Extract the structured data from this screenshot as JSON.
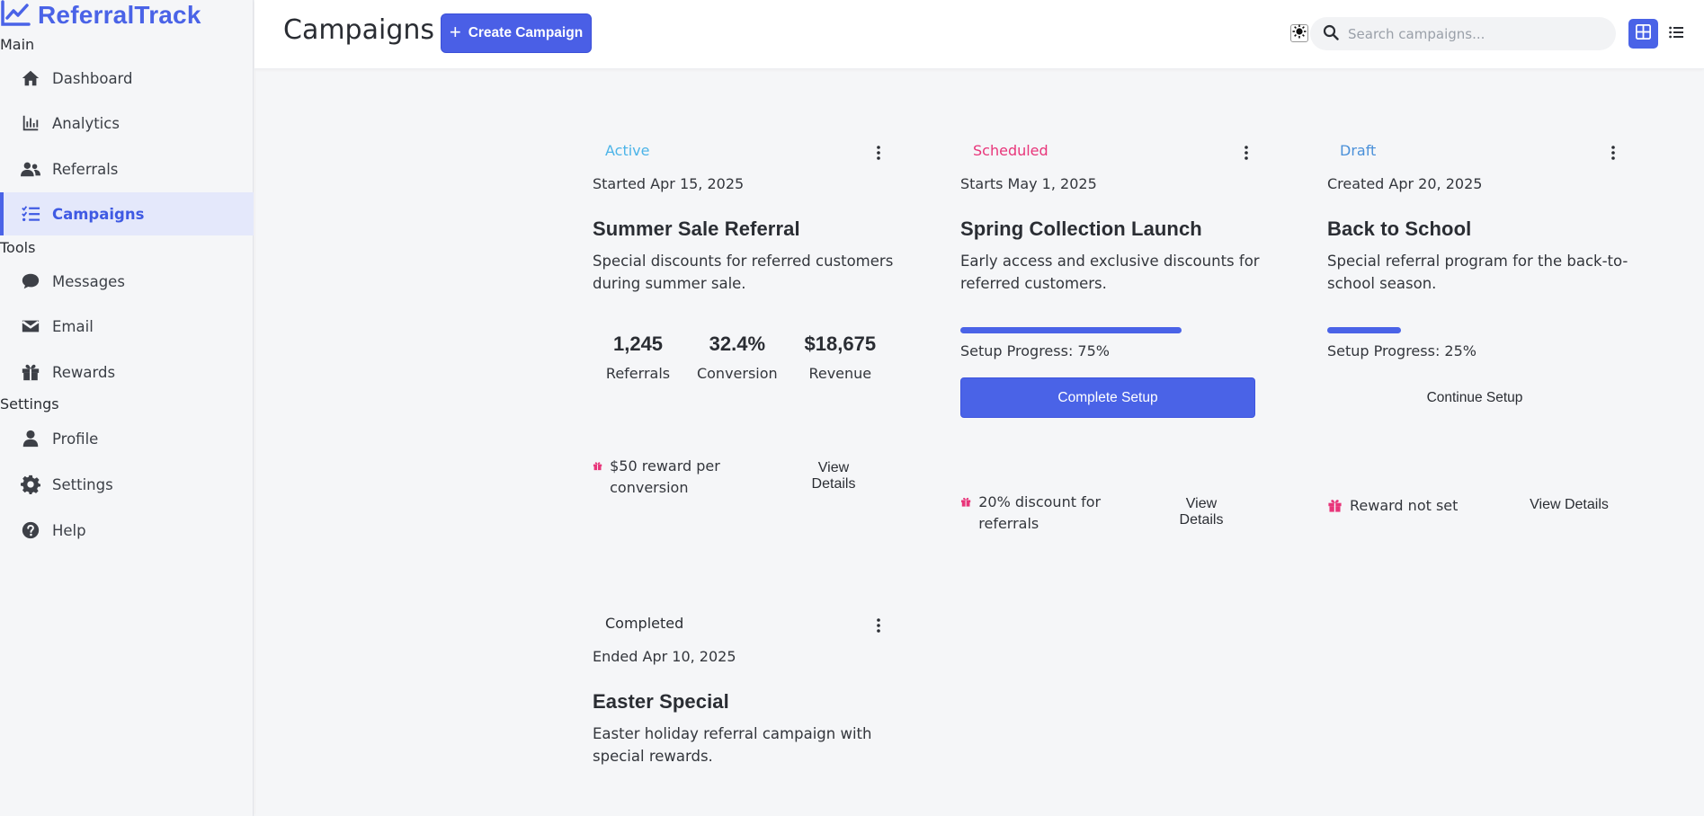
{
  "app": {
    "name": "ReferralTrack"
  },
  "sidebar": {
    "sections": [
      {
        "label": "Main",
        "items": [
          {
            "label": "Dashboard",
            "icon": "home-icon"
          },
          {
            "label": "Analytics",
            "icon": "chart-icon"
          },
          {
            "label": "Referrals",
            "icon": "users-icon"
          },
          {
            "label": "Campaigns",
            "icon": "list-check-icon",
            "active": true
          }
        ]
      },
      {
        "label": "Tools",
        "items": [
          {
            "label": "Messages",
            "icon": "chat-icon"
          },
          {
            "label": "Email",
            "icon": "envelope-icon"
          },
          {
            "label": "Rewards",
            "icon": "gift-icon"
          }
        ]
      },
      {
        "label": "Settings",
        "items": [
          {
            "label": "Profile",
            "icon": "user-icon"
          },
          {
            "label": "Settings",
            "icon": "gear-icon"
          },
          {
            "label": "Help",
            "icon": "question-circle-icon"
          }
        ]
      }
    ]
  },
  "header": {
    "title": "Campaigns",
    "create_label": "Create Campaign",
    "search_placeholder": "Search campaigns...",
    "search_value": ""
  },
  "campaigns": [
    {
      "status": "Active",
      "status_color": "#4cb4e8",
      "date": "Started Apr 15, 2025",
      "title": "Summer Sale Referral",
      "description": "Special discounts for referred customers during summer sale.",
      "stats": [
        {
          "value": "1,245",
          "label": "Referrals"
        },
        {
          "value": "32.4%",
          "label": "Conversion"
        },
        {
          "value": "$18,675",
          "label": "Revenue"
        }
      ],
      "reward": "$50 reward per conversion",
      "details_label": "View Details"
    },
    {
      "status": "Scheduled",
      "status_color": "#e8357a",
      "date": "Starts May 1, 2025",
      "title": "Spring Collection Launch",
      "description": "Early access and exclusive discounts for referred customers.",
      "progress": 0.75,
      "progress_label": "Setup Progress: 75%",
      "action_label": "Complete Setup",
      "reward": "20% discount for referrals",
      "details_label": "View Details"
    },
    {
      "status": "Draft",
      "status_color": "#4a90d9",
      "date": "Created Apr 20, 2025",
      "title": "Back to School",
      "description": "Special referral program for the back-to-school season.",
      "progress": 0.25,
      "progress_label": "Setup Progress: 25%",
      "action_label": "Continue Setup",
      "reward": "Reward not set",
      "details_label": "View Details"
    },
    {
      "status": "Completed",
      "status_color": "#2a2d33",
      "date": "Ended Apr 10, 2025",
      "title": "Easter Special",
      "description": "Easter holiday referral campaign with special rewards."
    }
  ],
  "colors": {
    "accent": "#4a63e7",
    "gift": "#e8357a"
  }
}
